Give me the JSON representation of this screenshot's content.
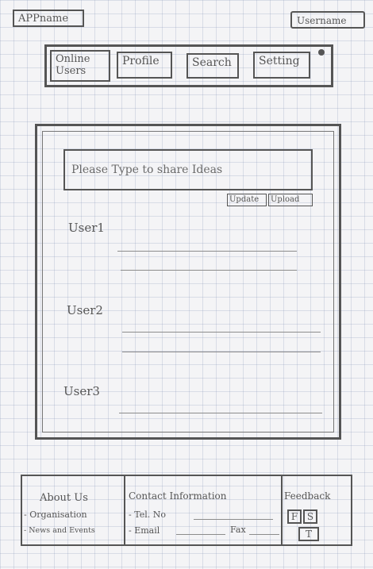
{
  "header": {
    "app_name": "APPname",
    "user_name": "Username"
  },
  "nav": {
    "tabs": [
      {
        "label": "Online Users"
      },
      {
        "label": "Profile"
      },
      {
        "label": "Search"
      },
      {
        "label": "Setting"
      }
    ]
  },
  "main": {
    "share_placeholder": "Please Type to share Ideas",
    "update_label": "Update",
    "upload_label": "Upload",
    "posts": [
      {
        "user": "User1"
      },
      {
        "user": "User2"
      },
      {
        "user": "User3"
      }
    ]
  },
  "footer": {
    "about": {
      "title": "About Us",
      "items": [
        "- Organisation",
        "- News and Events"
      ]
    },
    "contact": {
      "title": "Contact Information",
      "tel": "- Tel. No",
      "email": "- Email",
      "fax": "Fax"
    },
    "feedback": {
      "title": "Feedback",
      "buttons": [
        "F",
        "S",
        "T"
      ]
    }
  }
}
